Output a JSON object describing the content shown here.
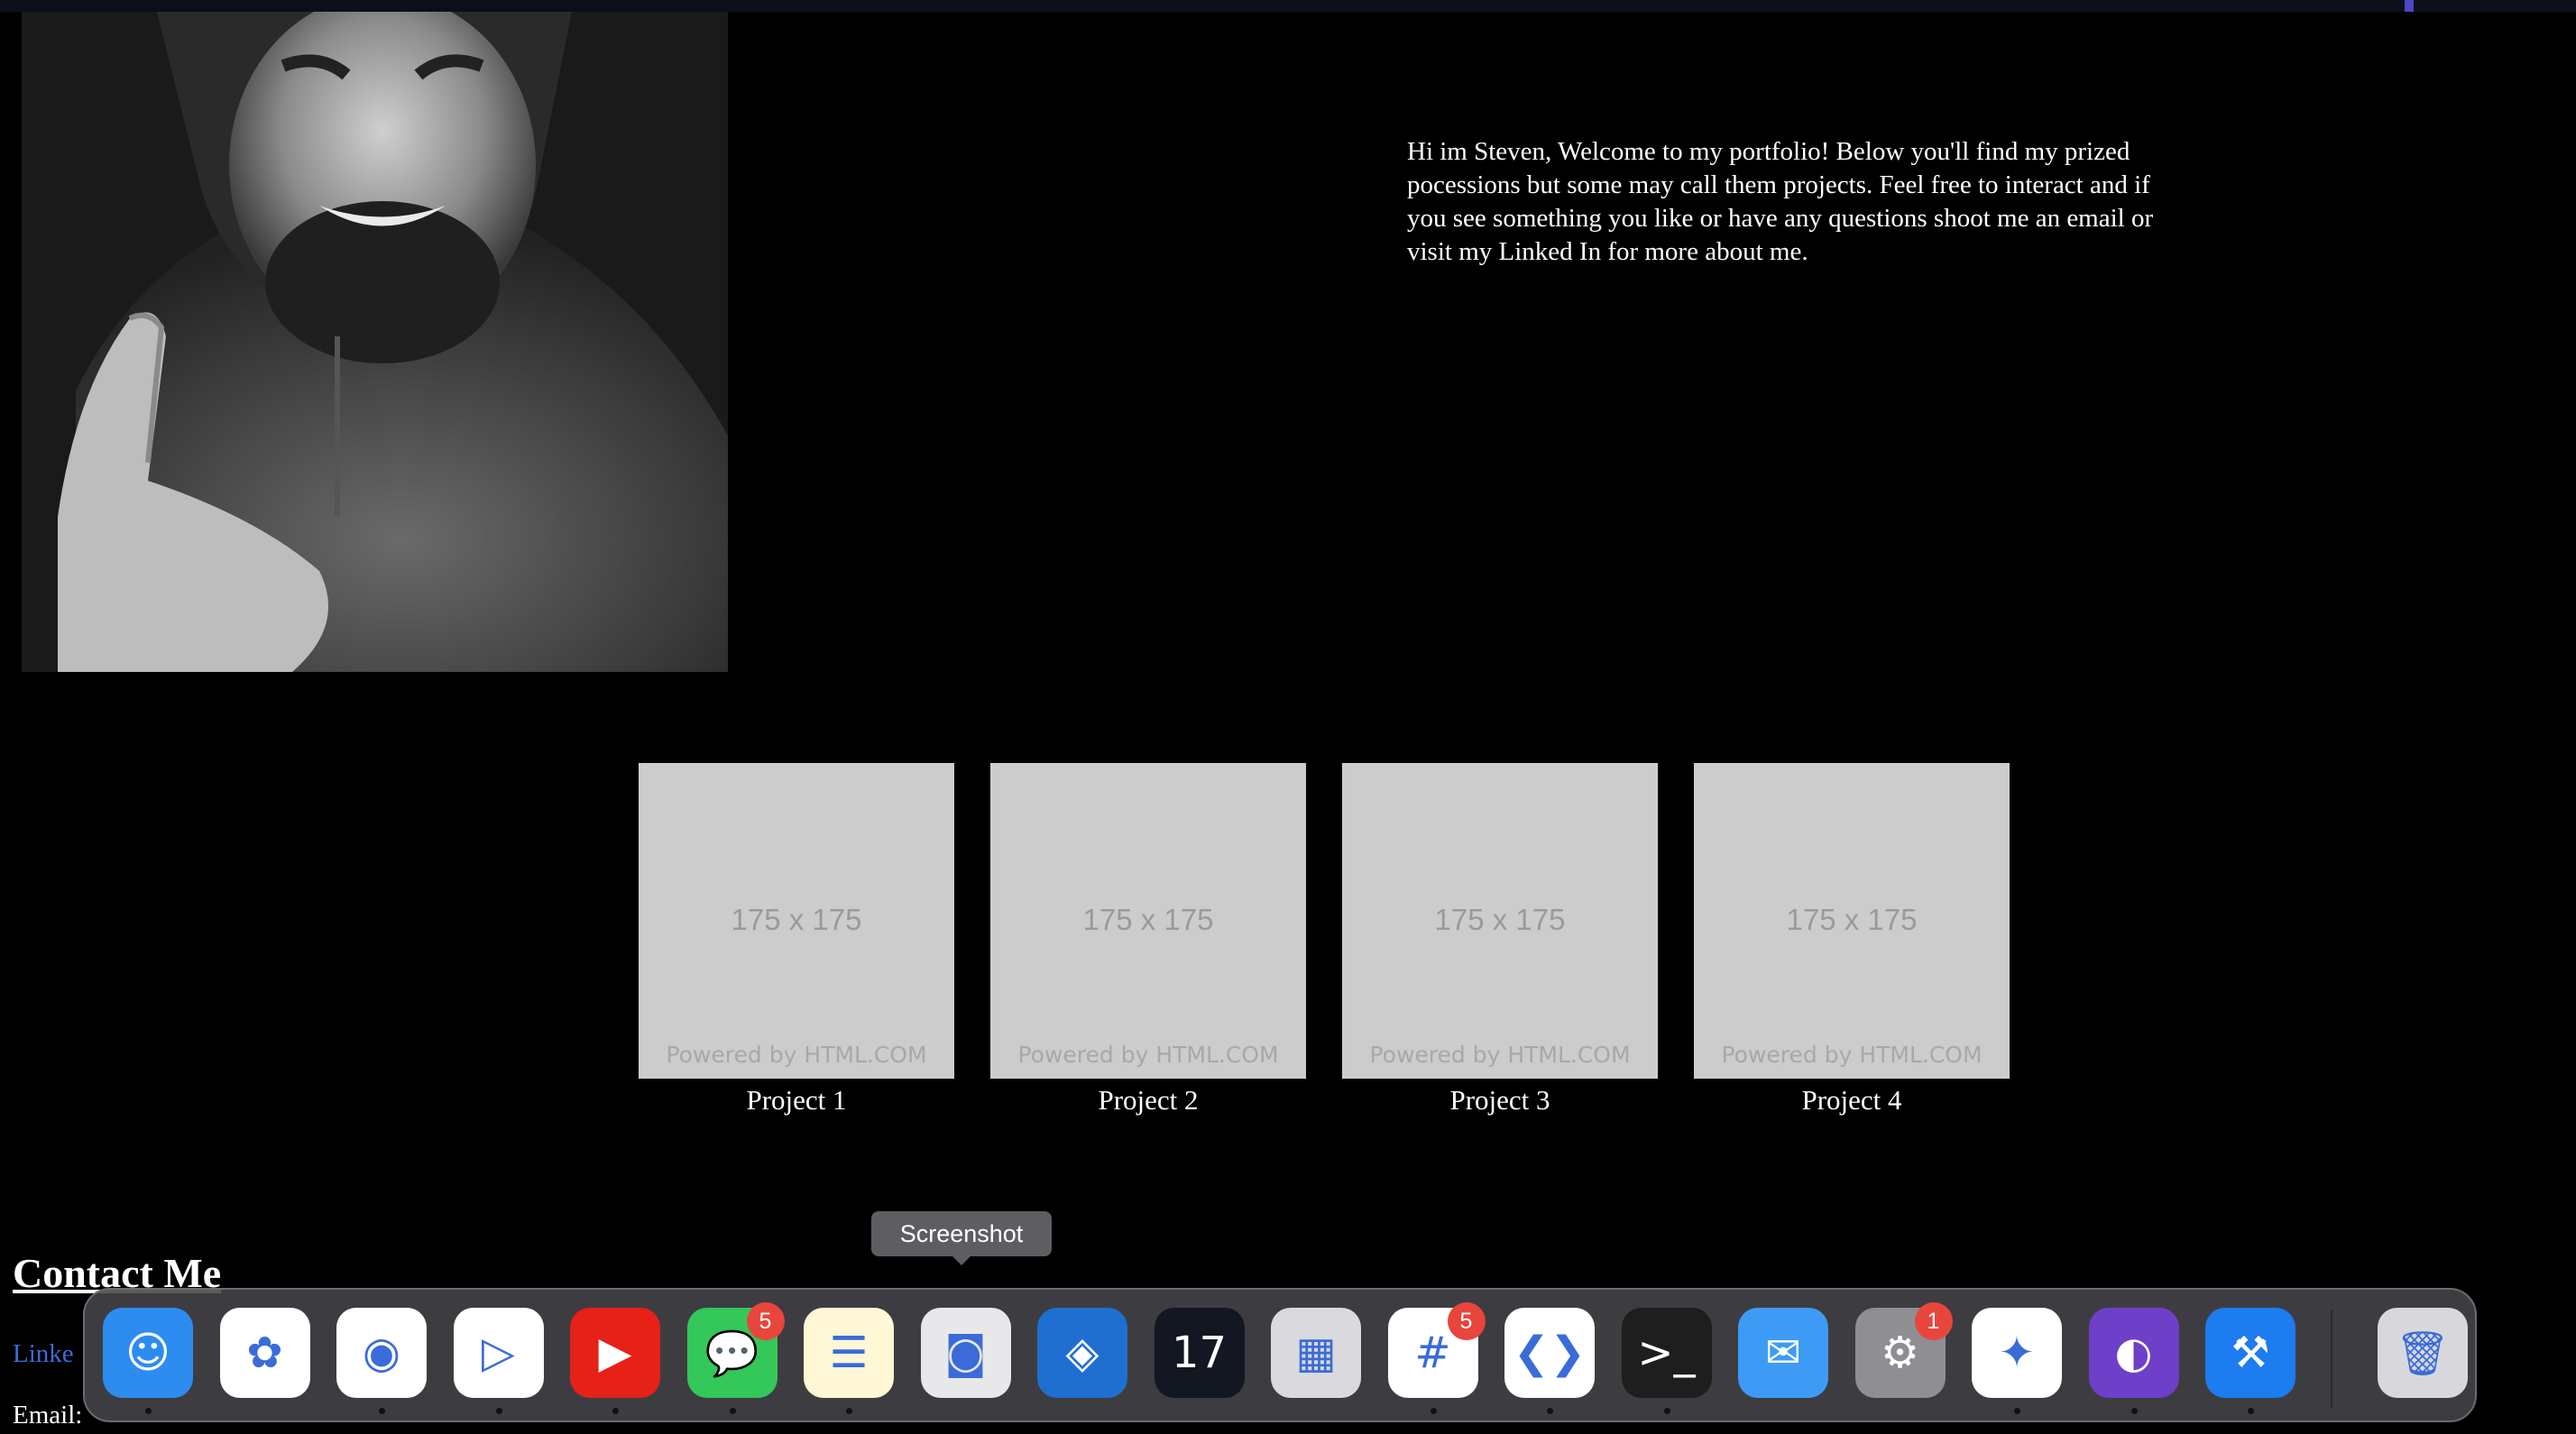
{
  "intro": {
    "text": "Hi im Steven, Welcome to my portfolio! Below you'll find my prized pocessions but some may call them projects. Feel free to interact and if you see something you like or have any questions shoot me an email or visit my Linked In for more about me."
  },
  "projects": [
    {
      "label": "Project 1",
      "thumb_dim": "175 x 175",
      "thumb_powered": "Powered by HTML.COM"
    },
    {
      "label": "Project 2",
      "thumb_dim": "175 x 175",
      "thumb_powered": "Powered by HTML.COM"
    },
    {
      "label": "Project 3",
      "thumb_dim": "175 x 175",
      "thumb_powered": "Powered by HTML.COM"
    },
    {
      "label": "Project 4",
      "thumb_dim": "175 x 175",
      "thumb_powered": "Powered by HTML.COM"
    }
  ],
  "contact": {
    "heading": "Contact Me",
    "linkedin_label": "Linke",
    "email_label": "Email:"
  },
  "dock": {
    "tooltip": "Screenshot",
    "items": [
      {
        "name": "finder-icon",
        "color": "#2d8cf0",
        "running": true
      },
      {
        "name": "photos-icon",
        "color": "#ffffff",
        "running": false
      },
      {
        "name": "chrome-icon",
        "color": "#ffffff",
        "running": true
      },
      {
        "name": "play-store-icon",
        "color": "#ffffff",
        "running": true
      },
      {
        "name": "youtube-icon",
        "color": "#e62117",
        "running": true
      },
      {
        "name": "messages-icon",
        "color": "#34c759",
        "running": true,
        "badge": "5"
      },
      {
        "name": "notes-icon",
        "color": "#fff7d6",
        "running": true
      },
      {
        "name": "screenshot-icon",
        "color": "#e8e8ea",
        "running": false
      },
      {
        "name": "metatrader-icon",
        "color": "#1f6fd1",
        "running": false
      },
      {
        "name": "tradingview-icon",
        "color": "#131722",
        "running": false
      },
      {
        "name": "launchpad-icon",
        "color": "#d9d9de",
        "running": false
      },
      {
        "name": "slack-icon",
        "color": "#ffffff",
        "running": true,
        "badge": "5"
      },
      {
        "name": "vscode-icon",
        "color": "#ffffff",
        "running": true
      },
      {
        "name": "terminal-icon",
        "color": "#1e1e1e",
        "running": true
      },
      {
        "name": "mail-icon",
        "color": "#3e9bf5",
        "running": false
      },
      {
        "name": "system-settings-icon",
        "color": "#8e8e93",
        "running": false,
        "badge": "1"
      },
      {
        "name": "safari-icon",
        "color": "#ffffff",
        "running": true
      },
      {
        "name": "github-desktop-icon",
        "color": "#6e40c9",
        "running": true
      },
      {
        "name": "xcode-icon",
        "color": "#1c7cf0",
        "running": true
      },
      {
        "name": "trash-icon",
        "color": "#d8d8dc",
        "running": false
      }
    ]
  }
}
